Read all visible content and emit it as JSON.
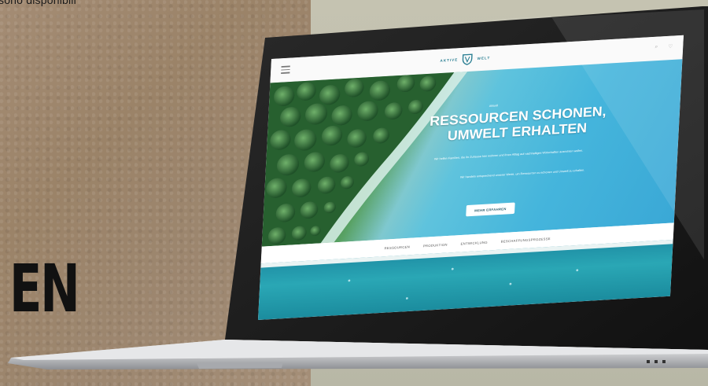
{
  "page": {
    "top_note": "sono disponibili",
    "language_label": "EN"
  },
  "website": {
    "logo_left": "AKTIVE",
    "logo_right": "WELT",
    "search_icon": "search-icon",
    "header_tools": "♡",
    "hero_tag": "Aktuell",
    "hero_title_line1": "RESSOURCEN SCHONEN,",
    "hero_title_line2": "UMWELT ERHALTEN",
    "hero_text": "Wir helfen Familien, die ihr Zuhause hier wohnen und ihren Alltag auf nachhaltiges Wirtschaften ausrichten wollen.",
    "hero_quote": "Wir handeln entsprechend unserer Werte, um Ressourcen zu schonen und Umwelt zu erhalten.",
    "cta_label": "MEHR ERFAHREN",
    "nav": [
      "RESSOURCEN",
      "PRODUKTION",
      "ENTWICKLUNG",
      "BESCHAFFUNGSPROZESSE"
    ]
  }
}
